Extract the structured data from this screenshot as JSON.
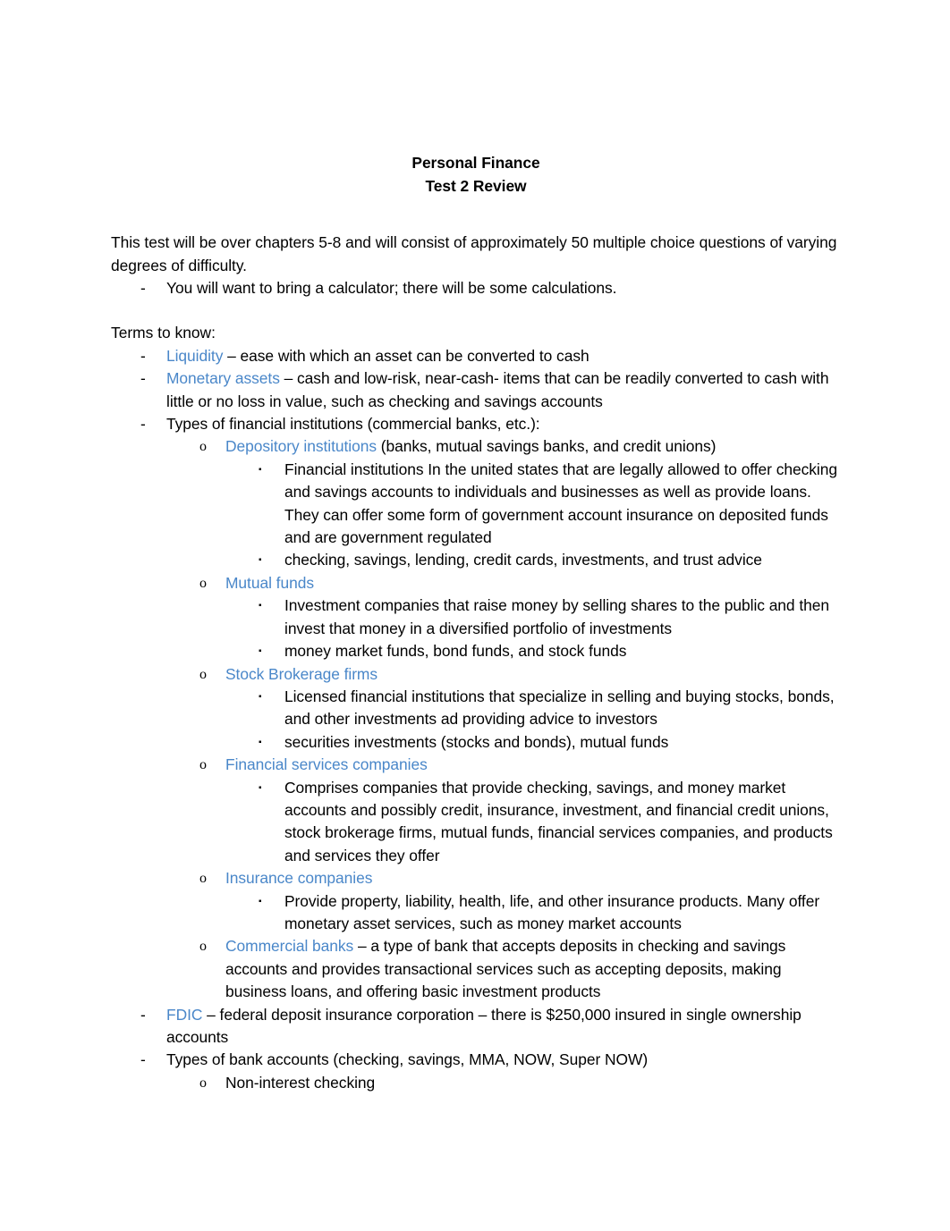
{
  "document": {
    "title_line1": "Personal Finance",
    "title_line2": "Test 2 Review",
    "intro_paragraph": "This test will be over chapters 5-8 and will consist of approximately 50 multiple choice questions of varying degrees of difficulty.",
    "intro_bullet": "You will want to bring a calculator; there will be some calculations.",
    "terms_heading": "Terms to know:",
    "accent_color": "#4a87c9",
    "body_color": "#000000",
    "background_color": "#ffffff",
    "bullets": {
      "dash": "-",
      "circle": "o",
      "square": "▪"
    },
    "terms": [
      {
        "term": "Liquidity",
        "body": " – ease with which an asset can be converted to cash"
      },
      {
        "term": "Monetary assets",
        "body": " – cash and low-risk, near-cash- items that can be readily converted to cash with little or no loss in value, such as checking and savings accounts"
      },
      {
        "term": "",
        "body": "Types of financial institutions (commercial banks, etc.):",
        "children": [
          {
            "term": "Depository institutions",
            "body": " (banks, mutual savings banks, and credit unions)",
            "children": [
              {
                "term": "",
                "body": "Financial institutions In the united states that are legally allowed to offer checking and savings accounts to individuals and businesses as well as provide loans. They can offer some form of government account insurance on deposited funds and are government regulated"
              },
              {
                "term": "",
                "body": "checking, savings, lending, credit cards, investments, and trust advice"
              }
            ]
          },
          {
            "term": "Mutual funds",
            "body": "",
            "children": [
              {
                "term": "",
                "body": "Investment companies that raise money by selling shares to the public and then invest that money in a diversified portfolio of investments"
              },
              {
                "term": "",
                "body": "money market funds, bond funds, and stock funds"
              }
            ]
          },
          {
            "term": "Stock Brokerage firms",
            "body": "",
            "children": [
              {
                "term": "",
                "body": "Licensed financial institutions that specialize in selling and buying stocks, bonds, and other investments ad providing advice to investors"
              },
              {
                "term": "",
                "body": "securities investments (stocks and bonds), mutual funds"
              }
            ]
          },
          {
            "term": "Financial services companies",
            "body": "",
            "children": [
              {
                "term": "",
                "body": "Comprises companies that provide checking, savings, and money market accounts and possibly credit, insurance, investment, and financial credit unions, stock brokerage firms, mutual funds, financial services companies, and products and services they offer"
              }
            ]
          },
          {
            "term": "Insurance companies",
            "body": "",
            "children": [
              {
                "term": "",
                "body": "Provide property, liability, health, life, and other insurance products. Many offer monetary asset services, such as money market accounts"
              }
            ]
          },
          {
            "term": "Commercial banks",
            "body": " – a type of bank that accepts deposits in checking and savings accounts and provides transactional services such as accepting deposits, making business loans, and offering basic investment products"
          }
        ]
      },
      {
        "term": "FDIC",
        "body": " – federal deposit insurance corporation – there is $250,000 insured in single ownership accounts"
      },
      {
        "term": "",
        "body": "Types of bank accounts (checking, savings, MMA, NOW, Super NOW)",
        "children": [
          {
            "term": "",
            "body": "Non-interest checking"
          }
        ]
      }
    ]
  }
}
